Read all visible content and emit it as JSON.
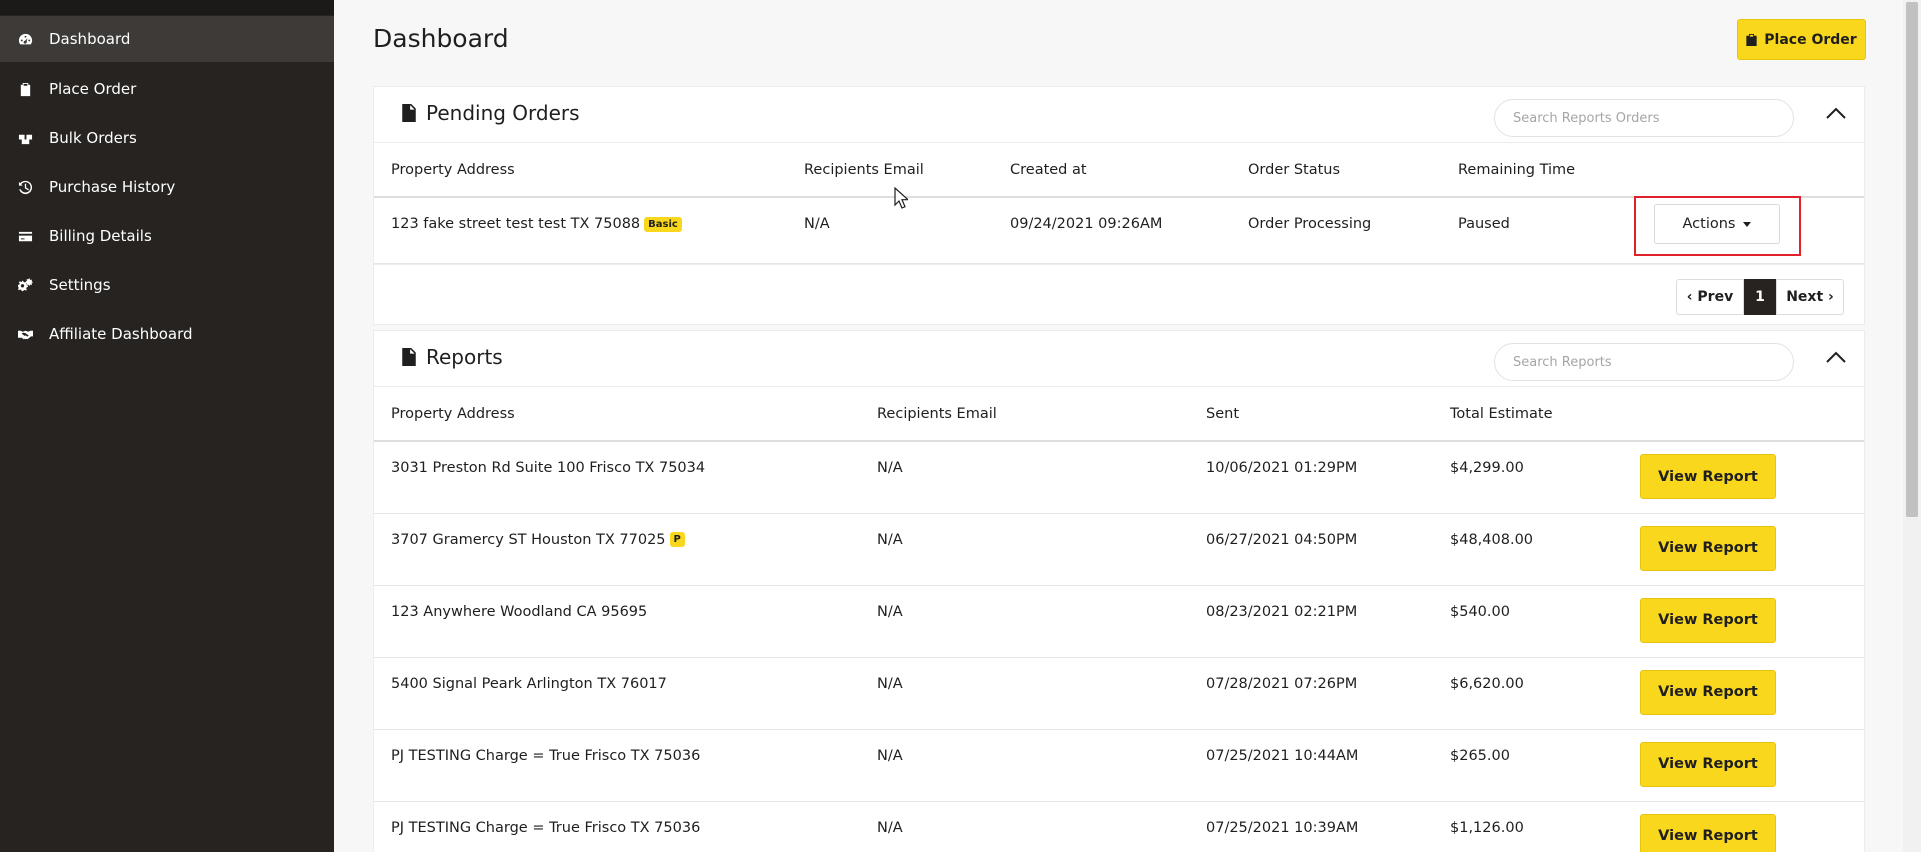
{
  "sidebar": {
    "items": [
      {
        "label": "Dashboard",
        "icon": "tachometer-icon",
        "active": true
      },
      {
        "label": "Place Order",
        "icon": "clipboard-icon"
      },
      {
        "label": "Bulk Orders",
        "icon": "boxes-icon"
      },
      {
        "label": "Purchase History",
        "icon": "history-icon"
      },
      {
        "label": "Billing Details",
        "icon": "credit-card-icon"
      },
      {
        "label": "Settings",
        "icon": "gears-icon"
      },
      {
        "label": "Affiliate Dashboard",
        "icon": "handshake-icon"
      }
    ]
  },
  "header": {
    "title": "Dashboard",
    "place_order_label": "Place Order"
  },
  "pending": {
    "title": "Pending Orders",
    "search_placeholder": "Search Reports Orders",
    "columns": [
      "Property Address",
      "Recipients Email",
      "Created at",
      "Order Status",
      "Remaining Time"
    ],
    "rows": [
      {
        "address": "123 fake street test test TX 75088",
        "badge": "Basic",
        "email": "N/A",
        "created": "09/24/2021 09:26AM",
        "status": "Order Processing",
        "remaining": "Paused",
        "action": "Actions"
      }
    ],
    "pager": {
      "prev": "‹ Prev",
      "current": "1",
      "next": "Next ›"
    }
  },
  "reports": {
    "title": "Reports",
    "search_placeholder": "Search Reports",
    "columns": [
      "Property Address",
      "Recipients Email",
      "Sent",
      "Total Estimate"
    ],
    "view_label": "View Report",
    "rows": [
      {
        "address": "3031 Preston Rd Suite 100 Frisco TX 75034",
        "badge": "",
        "email": "N/A",
        "sent": "10/06/2021 01:29PM",
        "total": "$4,299.00"
      },
      {
        "address": "3707 Gramercy ST Houston TX 77025",
        "badge": "P",
        "email": "N/A",
        "sent": "06/27/2021 04:50PM",
        "total": "$48,408.00"
      },
      {
        "address": "123 Anywhere Woodland CA 95695",
        "badge": "",
        "email": "N/A",
        "sent": "08/23/2021 02:21PM",
        "total": "$540.00"
      },
      {
        "address": "5400 Signal Peark Arlington TX 76017",
        "badge": "",
        "email": "N/A",
        "sent": "07/28/2021 07:26PM",
        "total": "$6,620.00"
      },
      {
        "address": "PJ TESTING Charge = True Frisco TX 75036",
        "badge": "",
        "email": "N/A",
        "sent": "07/25/2021 10:44AM",
        "total": "$265.00"
      },
      {
        "address": "PJ TESTING Charge = True Frisco TX 75036",
        "badge": "",
        "email": "N/A",
        "sent": "07/25/2021 10:39AM",
        "total": "$1,126.00"
      }
    ]
  },
  "colors": {
    "accent": "#f9d71c",
    "sidebar": "#262320",
    "highlight": "#e0202a"
  }
}
